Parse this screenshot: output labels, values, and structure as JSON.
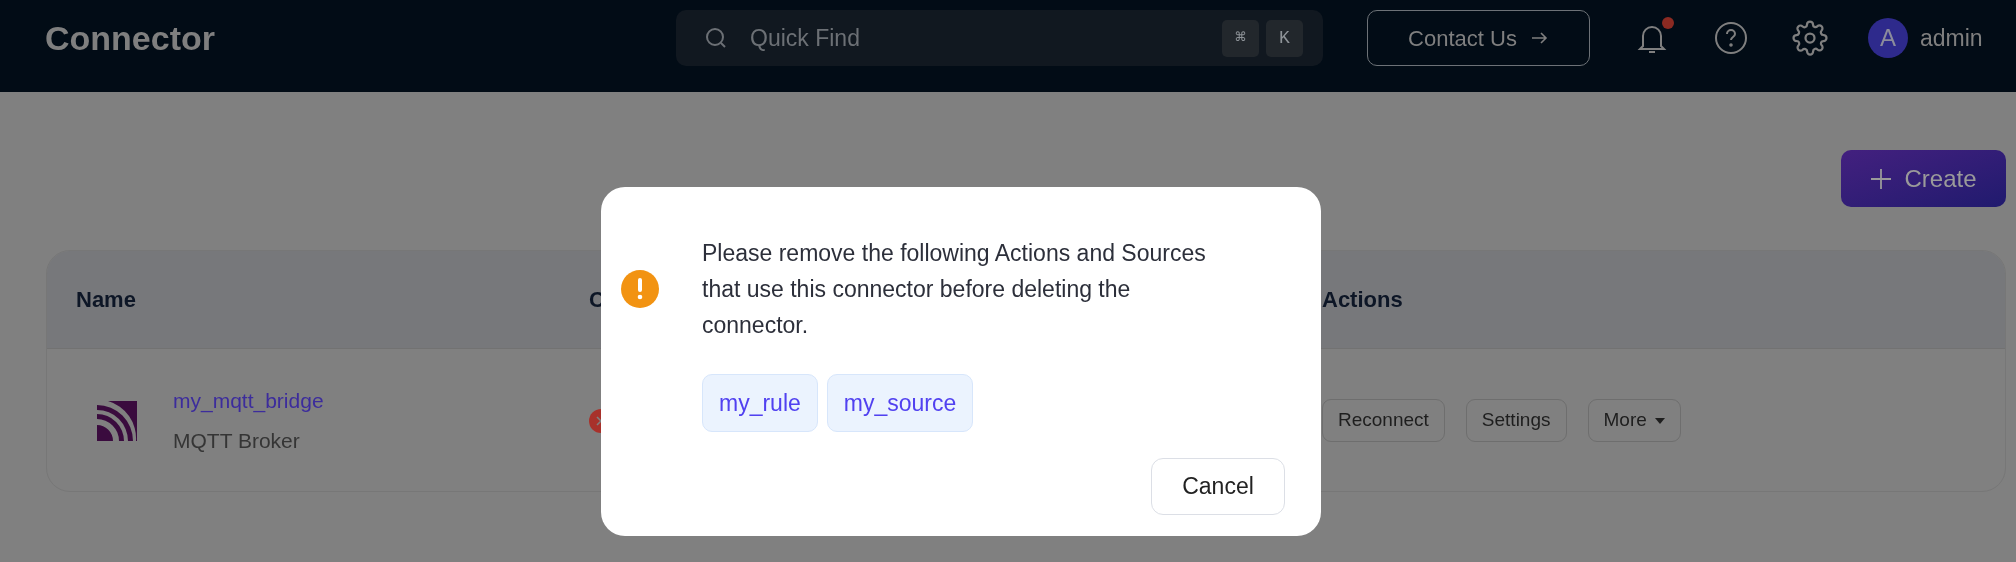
{
  "header": {
    "title": "Connector",
    "search": {
      "placeholder": "Quick Find",
      "shortcut": [
        "⌘",
        "K"
      ]
    },
    "contact_button": "Contact Us",
    "notifications": {
      "unread": true
    },
    "user": {
      "avatar": "A",
      "name": "admin"
    }
  },
  "toolbar": {
    "create_button": "Create"
  },
  "table": {
    "columns": [
      "Name",
      "C",
      "Actions"
    ],
    "rows": [
      {
        "name": "my_mqtt_bridge",
        "type": "MQTT Broker",
        "actions": [
          "Reconnect",
          "Settings",
          "More"
        ]
      }
    ]
  },
  "dialog": {
    "message": "Please remove the following Actions and Sources that use this connector before deleting the connector.",
    "tags": [
      "my_rule",
      "my_source"
    ],
    "cancel_button": "Cancel"
  }
}
